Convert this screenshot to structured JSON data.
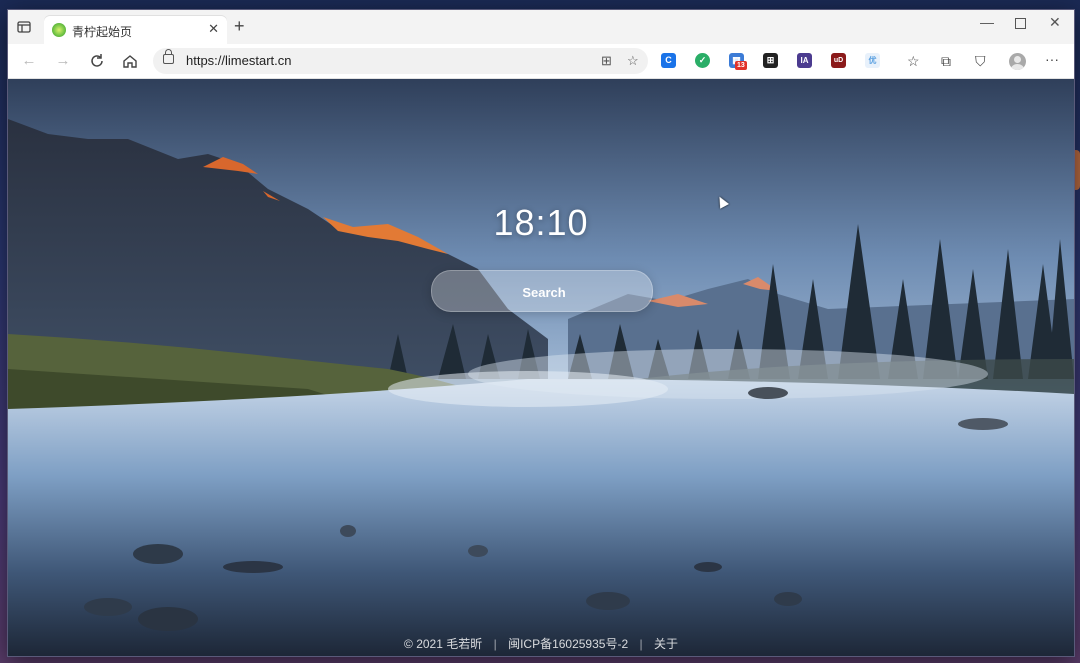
{
  "browser": {
    "tab": {
      "title": "青柠起始页"
    },
    "url": "https://limestart.cn",
    "extensions": [
      {
        "name": "edge-extension-blue",
        "color": "#1a73e8",
        "glyph": "C"
      },
      {
        "name": "wechat-extension",
        "color": "#2aae67",
        "glyph": "✓"
      },
      {
        "name": "tab-manager-extension",
        "color": "#3b7bd6",
        "glyph": "▦",
        "badge": "13"
      },
      {
        "name": "cube-extension",
        "color": "#222222",
        "glyph": "⊞"
      },
      {
        "name": "ia-extension",
        "color": "#4b3b8f",
        "glyph": "IA"
      },
      {
        "name": "ublock-extension",
        "color": "#8b1a1a",
        "glyph": "uD"
      },
      {
        "name": "translate-extension",
        "color": "#5aa0e0",
        "glyph": "优"
      }
    ]
  },
  "page": {
    "clock": "18:10",
    "search_placeholder": "Search",
    "footer": {
      "copyright": "© 2021 毛若昕",
      "icp": "闽ICP备16025935号-2",
      "about": "关于"
    }
  }
}
